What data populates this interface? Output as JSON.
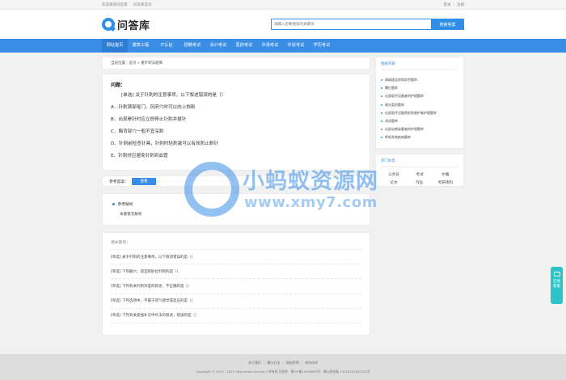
{
  "topbar": {
    "welcome": "欢迎来到问答库",
    "home_link": "问答库首页",
    "login": "登录",
    "register": "注册"
  },
  "header": {
    "logo_text": "问答库",
    "search_placeholder": "请输入您要搜索的关键词",
    "search_button": "搜索答案"
  },
  "nav": {
    "items": [
      "网站首页",
      "建筑工程",
      "IT认证",
      "招聘考试",
      "会计考试",
      "医药考试",
      "外语考试",
      "外贸考试",
      "学历考试"
    ]
  },
  "breadcrumb": "当前位置：首页 » 重针刺法题库",
  "question": {
    "title": "问题：",
    "text": "[单选] 关于针刺的注意事项，以下叙述错误的是（）",
    "options": [
      "A．针刺颈部哑门、风府穴时可以向上斜刺",
      "B．出现晕针时应立即停止针刺并拔针",
      "C．胸背部穴一般不宜深刺",
      "D．针刺前检查针具，针刺时轻刺激可以有效防止断针",
      "E．针刺时应避免针刺到血管"
    ]
  },
  "answer": {
    "label": "参考答案：",
    "button": "查看"
  },
  "analysis": {
    "title": "参考解析",
    "text": "本题暂无解析"
  },
  "related": {
    "title": "相关题目：",
    "items": [
      "[单选] 关于针刺的注意事项，以下叙述错误的是（）",
      "[单选] 下列腧穴，适宜刺卧位针刺的是（）",
      "[单选] 下列有关针刺深度的叙述，不正确的是（）",
      "[单选] 下列选项中，不属于得气感觉或反应的是（）",
      "[单选] 下列有关提插补泻中补法的叙述，错误的是（）"
    ]
  },
  "sidebar": {
    "related_title": "相关内容",
    "related_items": [
      "高级理念房地综合题库",
      "腾忆题库",
      "论部医疗设备者的护理题库",
      "政治类别题库",
      "论部医疗设备院前急救护者护理题库",
      "消化题库",
      "论部泌感染重者的护理题库",
      "呼吸系统疾病题库"
    ],
    "tags_title": "热门标签",
    "tags": [
      "公务员",
      "考试",
      "尔雅",
      "论文",
      "作业",
      "考研资料"
    ]
  },
  "footer": {
    "links": [
      "关于我们",
      "建口方法",
      "网站声明",
      "合作伙伴"
    ],
    "copyright": "Copyright © 2013 - 2021 http://edzls.fyo.net 八爷有限·问答库 · 豫ICP备14008659号 · 豫公网安备 14118102000122号"
  },
  "float_service": {
    "line1": "在线",
    "line2": "客服"
  },
  "watermark": {
    "text": "小蚂蚁资源网",
    "url": "www.xmy7.com"
  }
}
